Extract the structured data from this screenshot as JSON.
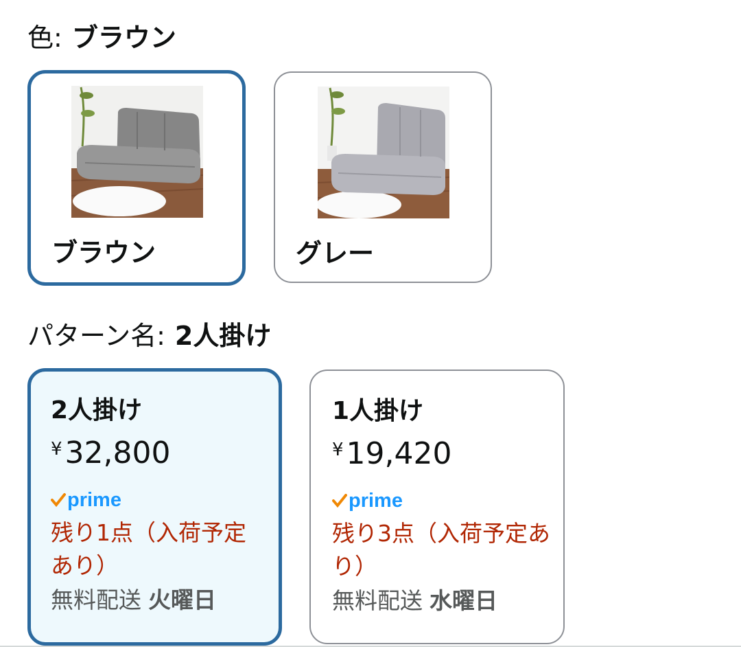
{
  "color_selector": {
    "label": "色:",
    "selected_value": "ブラウン",
    "swatches": [
      {
        "label": "ブラウン",
        "selected": true
      },
      {
        "label": "グレー",
        "selected": false
      }
    ]
  },
  "pattern_selector": {
    "label": "パターン名:",
    "selected_value": "2人掛け",
    "options": [
      {
        "title": "2人掛け",
        "currency": "¥",
        "price": "32,800",
        "prime_badge": "prime",
        "stock": "残り1点（入荷予定あり）",
        "shipping_prefix": "無料配送",
        "shipping_day": "火曜日",
        "selected": true
      },
      {
        "title": "1人掛け",
        "currency": "¥",
        "price": "19,420",
        "prime_badge": "prime",
        "stock": "残り3点（入荷予定あり）",
        "shipping_prefix": "無料配送",
        "shipping_day": "水曜日",
        "selected": false
      }
    ]
  },
  "colors": {
    "selected_border": "#2c6a9f",
    "selected_bg": "#eef9fd",
    "stock_red": "#b12704",
    "prime_blue": "#1a98ff",
    "prime_check": "#f08804"
  }
}
